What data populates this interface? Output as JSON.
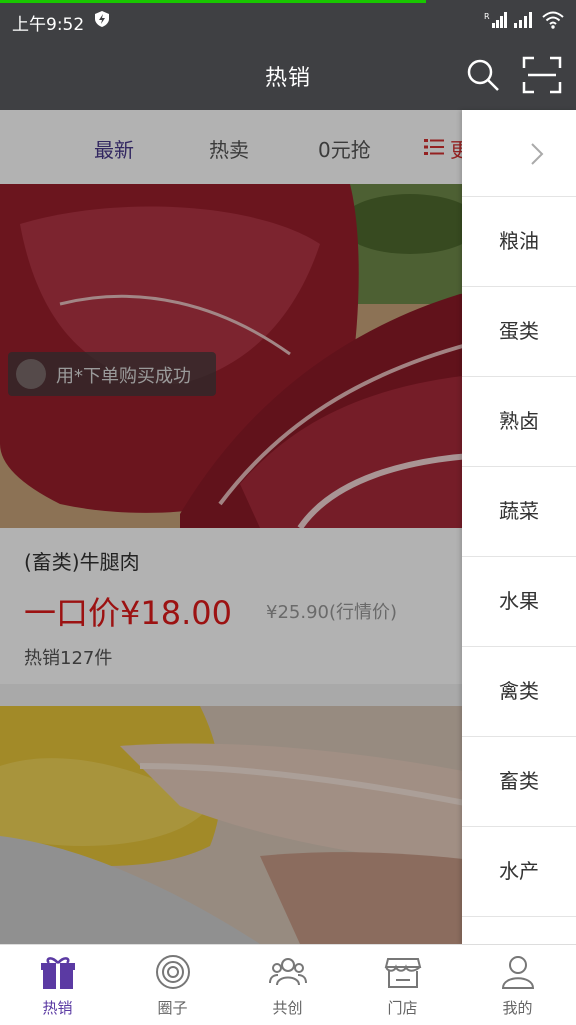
{
  "status": {
    "time": "上午9:52",
    "signal1_label": "R"
  },
  "header": {
    "title": "热销"
  },
  "filters": {
    "newest": "最新",
    "hot": "热卖",
    "zero": "0元抢",
    "more": "更"
  },
  "product": {
    "toast": "用*下单购买成功",
    "name": "(畜类)牛腿肉",
    "price": "一口价¥18.00",
    "old_price": "¥25.90(行情价)",
    "sold": "热销127件"
  },
  "drawer": {
    "items": [
      "粮油",
      "蛋类",
      "熟卤",
      "蔬菜",
      "水果",
      "禽类",
      "畜类",
      "水产"
    ]
  },
  "tabs": [
    {
      "label": "热销",
      "icon": "gift-icon"
    },
    {
      "label": "圈子",
      "icon": "circle-target-icon"
    },
    {
      "label": "共创",
      "icon": "users-icon"
    },
    {
      "label": "门店",
      "icon": "store-icon"
    },
    {
      "label": "我的",
      "icon": "user-icon"
    }
  ],
  "colors": {
    "header_bg": "#3f4043",
    "active_tab": "#5b3aa3",
    "price": "#e01b1b",
    "progress": "#19c700"
  }
}
